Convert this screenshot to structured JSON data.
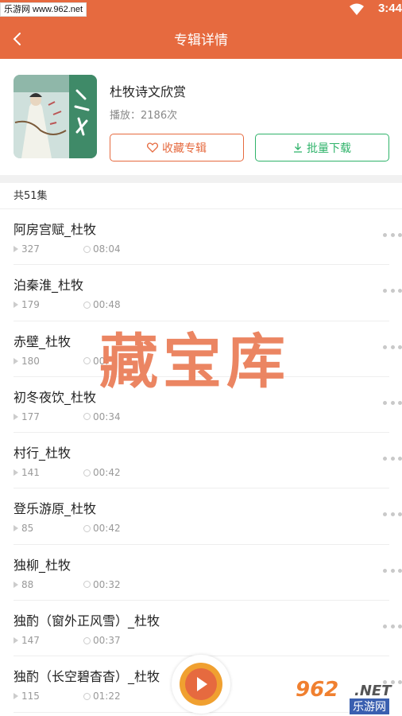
{
  "statusbar": {
    "watermark": "乐游网 www.962.net",
    "time": "3:44"
  },
  "header": {
    "title": "专辑详情"
  },
  "album": {
    "title": "杜牧诗文欣赏",
    "plays": "播放：2186次",
    "fav_label": "收藏专辑",
    "download_label": "批量下载"
  },
  "list": {
    "count": "共51集",
    "items": [
      {
        "title": "阿房宫赋_杜牧",
        "plays": "327",
        "duration": "08:04"
      },
      {
        "title": "泊秦淮_杜牧",
        "plays": "179",
        "duration": "00:48"
      },
      {
        "title": "赤壁_杜牧",
        "plays": "180",
        "duration": "00:"
      },
      {
        "title": "初冬夜饮_杜牧",
        "plays": "177",
        "duration": "00:34"
      },
      {
        "title": "村行_杜牧",
        "plays": "141",
        "duration": "00:42"
      },
      {
        "title": "登乐游原_杜牧",
        "plays": "85",
        "duration": "00:42"
      },
      {
        "title": "独柳_杜牧",
        "plays": "88",
        "duration": "00:32"
      },
      {
        "title": "独酌（窗外正风雪）_杜牧",
        "plays": "147",
        "duration": "00:37"
      },
      {
        "title": "独酌（长空碧杳杳）_杜牧",
        "plays": "115",
        "duration": "01:22"
      }
    ]
  },
  "overlay": {
    "watermark_center": "藏宝库",
    "logo_number": "962",
    "logo_net": ".NET",
    "logo_cn": "乐游网"
  },
  "colors": {
    "accent": "#e66a3f",
    "green": "#2fb36a"
  }
}
